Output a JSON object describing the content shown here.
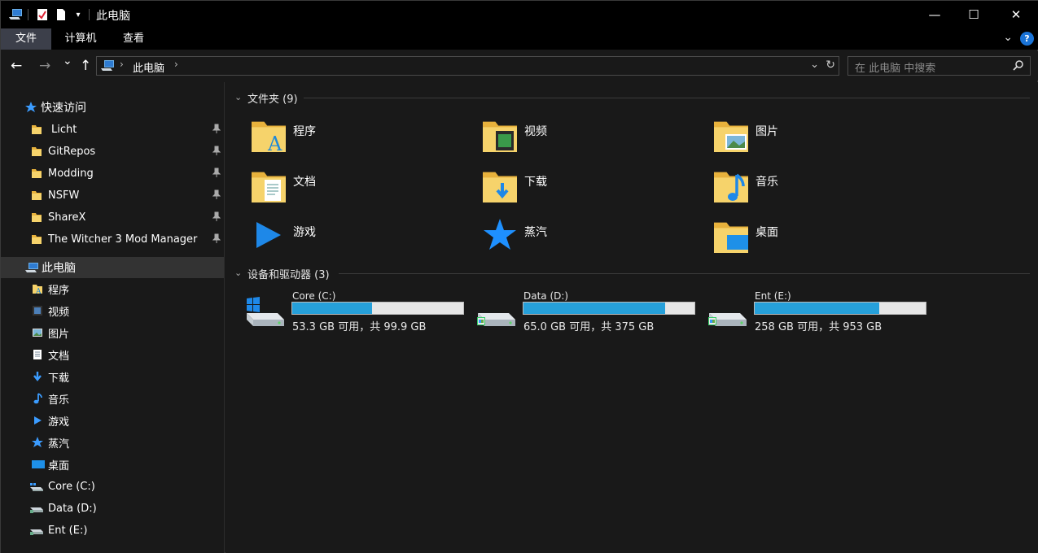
{
  "window": {
    "title": "此电脑",
    "minimize": "—",
    "maximize": "☐",
    "close": "✕"
  },
  "ribbon": {
    "tabs": [
      {
        "label": "文件",
        "active": true
      },
      {
        "label": "计算机",
        "active": false
      },
      {
        "label": "查看",
        "active": false
      }
    ],
    "help": "?"
  },
  "nav": {
    "back": "←",
    "forward": "→",
    "recent": "⌄",
    "up": "↑",
    "breadcrumb": "此电脑",
    "search_placeholder": "在 此电脑 中搜索"
  },
  "sidebar": {
    "quick_access": "快速访问",
    "pinned": [
      "Licht",
      "GitRepos",
      "Modding",
      "NSFW",
      "ShareX",
      "The Witcher 3 Mod Manager"
    ],
    "this_pc": "此电脑",
    "pc_items": [
      {
        "label": "程序",
        "icon": "programs-icon"
      },
      {
        "label": "视频",
        "icon": "videos-icon"
      },
      {
        "label": "图片",
        "icon": "pictures-icon"
      },
      {
        "label": "文档",
        "icon": "documents-icon"
      },
      {
        "label": "下载",
        "icon": "downloads-icon"
      },
      {
        "label": "音乐",
        "icon": "music-icon"
      },
      {
        "label": "游戏",
        "icon": "games-icon"
      },
      {
        "label": "蒸汽",
        "icon": "steam-icon"
      },
      {
        "label": "桌面",
        "icon": "desktop-icon"
      },
      {
        "label": "Core (C:)",
        "icon": "drive-c-icon"
      },
      {
        "label": "Data (D:)",
        "icon": "drive-d-icon"
      },
      {
        "label": "Ent (E:)",
        "icon": "drive-e-icon"
      }
    ]
  },
  "folders": {
    "header": "文件夹 (9)",
    "items": [
      {
        "label": "程序",
        "icon": "programs-icon"
      },
      {
        "label": "视频",
        "icon": "videos-icon"
      },
      {
        "label": "图片",
        "icon": "pictures-icon"
      },
      {
        "label": "文档",
        "icon": "documents-icon"
      },
      {
        "label": "下载",
        "icon": "downloads-icon"
      },
      {
        "label": "音乐",
        "icon": "music-icon"
      },
      {
        "label": "游戏",
        "icon": "games-icon"
      },
      {
        "label": "蒸汽",
        "icon": "steam-icon"
      },
      {
        "label": "桌面",
        "icon": "desktop-icon"
      }
    ]
  },
  "drives": {
    "header": "设备和驱动器 (3)",
    "items": [
      {
        "name": "Core (C:)",
        "free_text": "53.3 GB 可用，共 99.9 GB",
        "used_fraction": 0.466
      },
      {
        "name": "Data (D:)",
        "free_text": "65.0 GB 可用，共 375 GB",
        "used_fraction": 0.827
      },
      {
        "name": "Ent (E:)",
        "free_text": "258 GB 可用，共 953 GB",
        "used_fraction": 0.729
      }
    ]
  },
  "colors": {
    "accent": "#26a0da",
    "folder": "#f3c74f",
    "blue_icon": "#1e90e8"
  }
}
